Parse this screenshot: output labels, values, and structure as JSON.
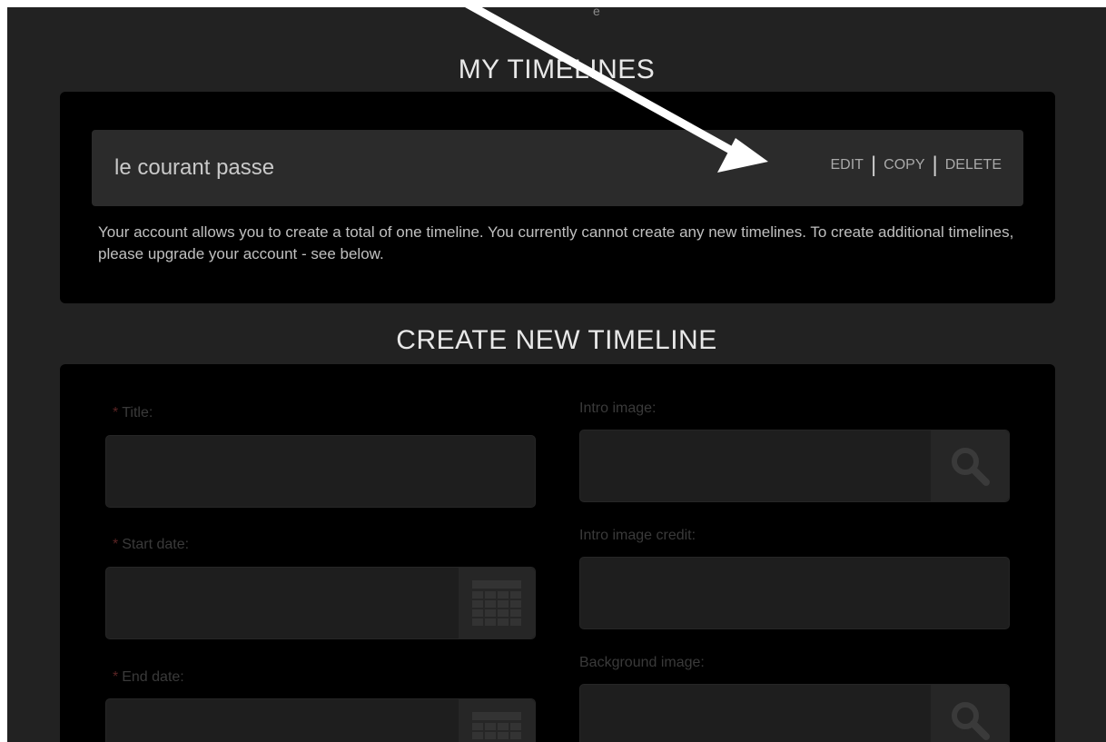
{
  "header": {
    "top_fragment": "e"
  },
  "my_timelines": {
    "heading": "MY TIMELINES",
    "timelines": [
      {
        "name": "le courant passe",
        "actions": {
          "edit": "EDIT",
          "copy": "COPY",
          "delete": "DELETE",
          "separator": "|"
        }
      }
    ],
    "account_note": "Your account allows you to create a total of one timeline. You currently cannot create any new timelines. To create additional timelines, please upgrade your account - see below."
  },
  "create_timeline": {
    "heading": "CREATE NEW TIMELINE",
    "required_marker": "*",
    "fields": {
      "title": {
        "label": "Title:",
        "value": ""
      },
      "start_date": {
        "label": "Start date:",
        "value": "",
        "icon": "calendar-icon"
      },
      "end_date": {
        "label": "End date:",
        "value": "",
        "icon": "calendar-icon"
      },
      "intro_image": {
        "label": "Intro image:",
        "value": "",
        "icon": "search-icon"
      },
      "intro_image_credit": {
        "label": "Intro image credit:",
        "value": ""
      },
      "background_image": {
        "label": "Background image:",
        "value": "",
        "icon": "search-icon"
      }
    }
  },
  "colors": {
    "page_bg": "#222222",
    "panel_bg": "#000000",
    "row_bg": "#2b2b2b",
    "input_bg": "#1e1e1e",
    "heading_text": "#e8e8e8",
    "annotation_arrow": "#ffffff"
  }
}
